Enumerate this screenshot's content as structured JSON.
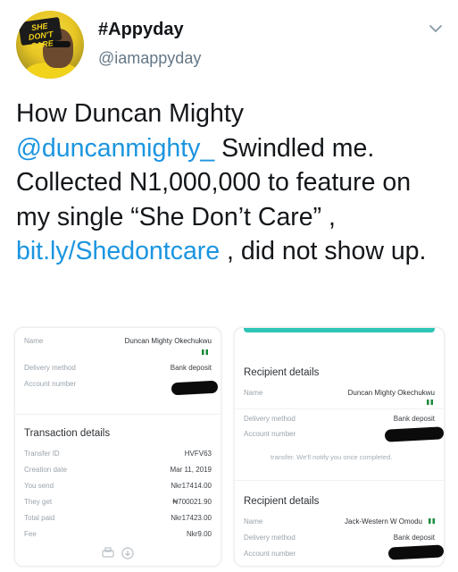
{
  "tweet": {
    "display_name": "#Appyday",
    "handle": "@iamappyday",
    "avatar_text": "SHE DON'T CARE",
    "text_parts": {
      "p1": "How Duncan Mighty",
      "mention": "@duncanmighty_",
      "p2": " Swindled me. Collected N1,000,000 to feature on my single “She Don’t Care” ,",
      "link": "bit.ly/Shedontcare",
      "p3": " , did not show up."
    }
  },
  "left_card": {
    "name_label": "Name",
    "name_value": "Duncan Mighty Okechukwu",
    "delivery_label": "Delivery method",
    "delivery_value": "Bank deposit",
    "account_label": "Account number",
    "transaction_title": "Transaction details",
    "rows": [
      {
        "k": "Transfer ID",
        "v": "HVFV63"
      },
      {
        "k": "Creation date",
        "v": "Mar 11, 2019"
      },
      {
        "k": "You send",
        "v": "Nkr17414.00"
      },
      {
        "k": "They get",
        "v": "₦700021.90"
      },
      {
        "k": "Total paid",
        "v": "Nkr17423.00"
      },
      {
        "k": "Fee",
        "v": "Nkr9.00"
      }
    ]
  },
  "right_card": {
    "recipient_title_1": "Recipient details",
    "name_label": "Name",
    "name_value": "Duncan Mighty Okechukwu",
    "delivery_label": "Delivery method",
    "delivery_value": "Bank deposit",
    "account_label": "Account number",
    "notice": "transfer. We'll notify you once completed.",
    "recipient_title_2": "Recipient details",
    "name2_label": "Name",
    "name2_value": "Jack-Western W Omodu",
    "delivery2_label": "Delivery method",
    "delivery2_value": "Bank deposit",
    "account2_label": "Account number"
  },
  "colors": {
    "link": "#1b95e0",
    "accent_bar": "#2ec4b6",
    "flag_green": "#1a8a3a"
  },
  "icons": {
    "more": "chevron-down-icon",
    "print": "print-icon",
    "download": "download-icon"
  }
}
